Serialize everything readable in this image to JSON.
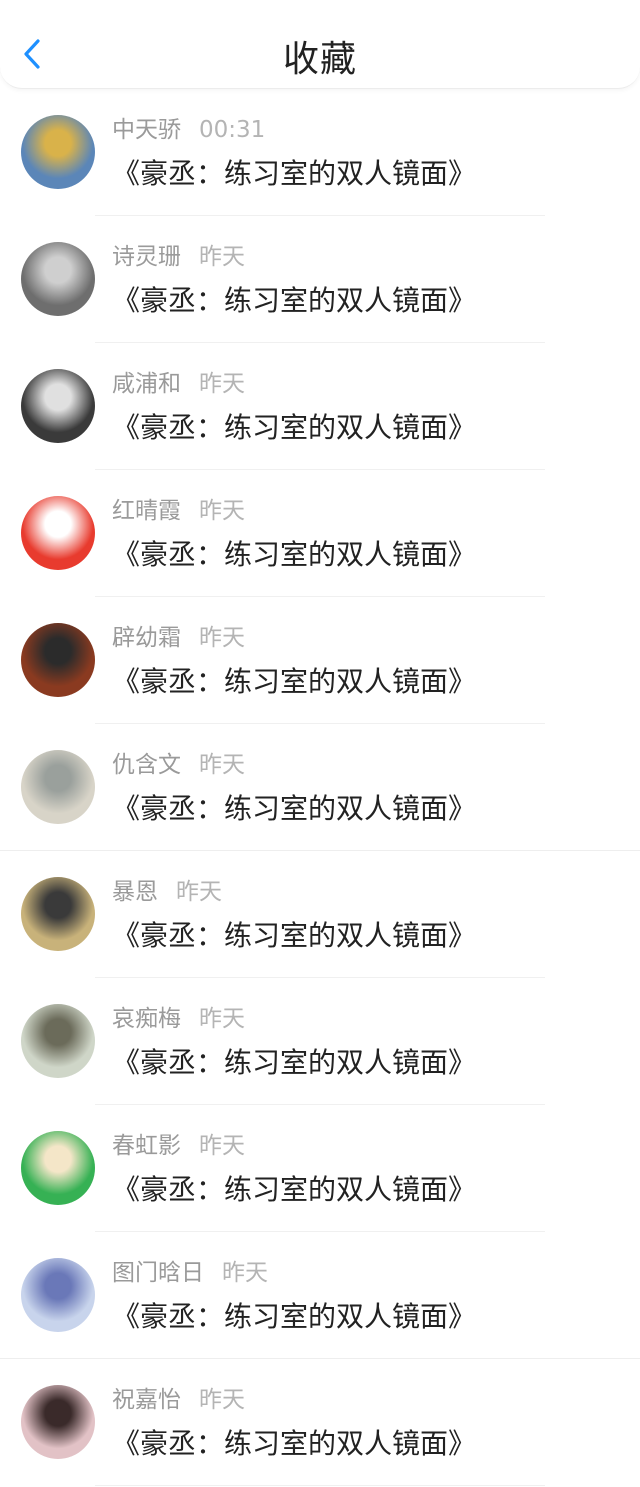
{
  "header": {
    "title": "收藏"
  },
  "items": [
    {
      "name": "中天骄",
      "time": "00:31",
      "book": "《豪丞：练习室的双人镜面》",
      "avatar_color": "#5b86b8",
      "avatar_accent": "#d9b24a"
    },
    {
      "name": "诗灵珊",
      "time": "昨天",
      "book": "《豪丞：练习室的双人镜面》",
      "avatar_color": "#6e6e6e",
      "avatar_accent": "#cfcfcf"
    },
    {
      "name": "咸浦和",
      "time": "昨天",
      "book": "《豪丞：练习室的双人镜面》",
      "avatar_color": "#3a3a3a",
      "avatar_accent": "#e0e0e0"
    },
    {
      "name": "红晴霞",
      "time": "昨天",
      "book": "《豪丞：练习室的双人镜面》",
      "avatar_color": "#e83b2e",
      "avatar_accent": "#ffffff"
    },
    {
      "name": "辟幼霜",
      "time": "昨天",
      "book": "《豪丞：练习室的双人镜面》",
      "avatar_color": "#8a3a20",
      "avatar_accent": "#2b2b2b"
    },
    {
      "name": "仇含文",
      "time": "昨天",
      "book": "《豪丞：练习室的双人镜面》",
      "avatar_color": "#d8d4c8",
      "avatar_accent": "#9aa09c"
    },
    {
      "name": "暴恩",
      "time": "昨天",
      "book": "《豪丞：练习室的双人镜面》",
      "avatar_color": "#c8b27a",
      "avatar_accent": "#3a3a3a"
    },
    {
      "name": "哀痴梅",
      "time": "昨天",
      "book": "《豪丞：练习室的双人镜面》",
      "avatar_color": "#cfd6c8",
      "avatar_accent": "#6b6b5a"
    },
    {
      "name": "春虹影",
      "time": "昨天",
      "book": "《豪丞：练习室的双人镜面》",
      "avatar_color": "#36b154",
      "avatar_accent": "#f4e6c8"
    },
    {
      "name": "图门晗日",
      "time": "昨天",
      "book": "《豪丞：练习室的双人镜面》",
      "avatar_color": "#c8d4ec",
      "avatar_accent": "#6a78b8"
    },
    {
      "name": "祝嘉怡",
      "time": "昨天",
      "book": "《豪丞：练习室的双人镜面》",
      "avatar_color": "#e2c2c6",
      "avatar_accent": "#3a2a2a"
    }
  ],
  "colors": {
    "accent": "#1e90ff",
    "text": "#222222",
    "subtext": "#9a9a9a"
  }
}
